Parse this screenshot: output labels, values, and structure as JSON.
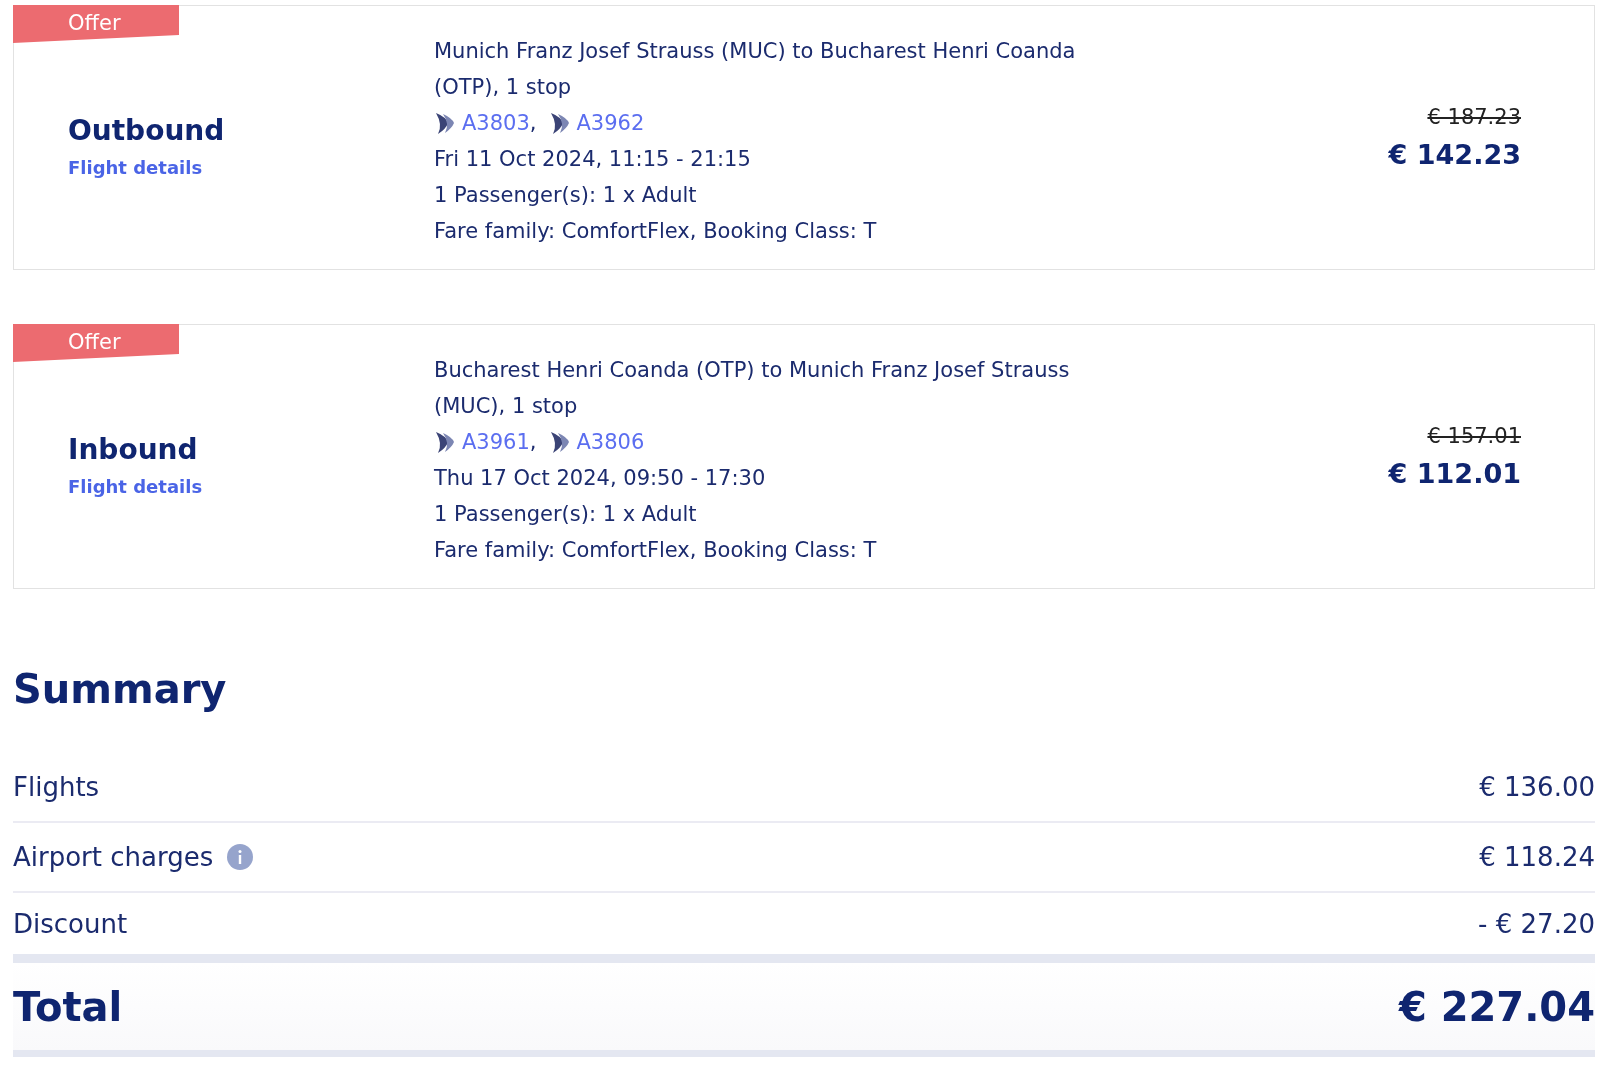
{
  "flights": [
    {
      "badge": "Offer",
      "direction": "Outbound",
      "details_link": "Flight details",
      "route": "Munich Franz Josef Strauss (MUC) to Bucharest Henri Coanda (OTP), 1 stop",
      "flight_numbers": [
        "A3803",
        "A3962"
      ],
      "separator": ",",
      "date_time": "Fri 11 Oct 2024, 11:15 - 21:15",
      "passengers": "1 Passenger(s): 1 x Adult",
      "fare": "Fare family: ComfortFlex, Booking Class: T",
      "old_price": "€ 187.23",
      "price": "€ 142.23"
    },
    {
      "badge": "Offer",
      "direction": "Inbound",
      "details_link": "Flight details",
      "route": "Bucharest Henri Coanda (OTP) to Munich Franz Josef Strauss (MUC), 1 stop",
      "flight_numbers": [
        "A3961",
        "A3806"
      ],
      "separator": ",",
      "date_time": "Thu 17 Oct 2024, 09:50 - 17:30",
      "passengers": "1 Passenger(s): 1 x Adult",
      "fare": "Fare family: ComfortFlex, Booking Class: T",
      "old_price": "€ 157.01",
      "price": "€ 112.01"
    }
  ],
  "summary": {
    "title": "Summary",
    "rows": [
      {
        "label": "Flights",
        "amount": "€ 136.00",
        "info": false
      },
      {
        "label": "Airport charges",
        "amount": "€ 118.24",
        "info": true
      },
      {
        "label": "Discount",
        "amount": "- € 27.20",
        "info": false
      }
    ],
    "total": {
      "label": "Total",
      "amount": "€ 227.04"
    }
  }
}
